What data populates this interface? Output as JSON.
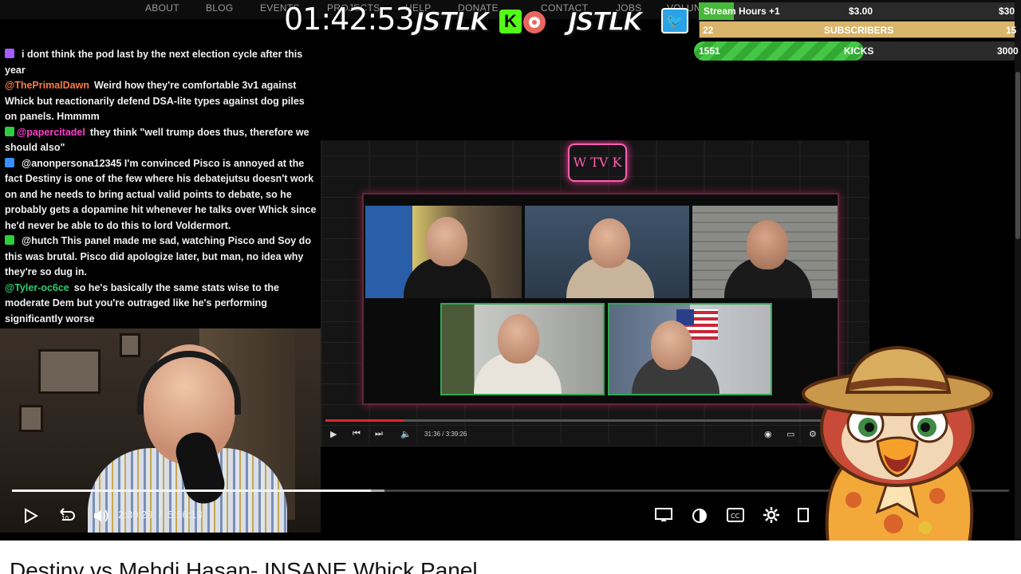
{
  "site_nav": [
    "ABOUT",
    "BLOG",
    "EVENTS",
    "PROJECTS",
    "HELP",
    "DONATE",
    "CONTACT",
    "JOBS",
    "VOLUNTEER"
  ],
  "overlay": {
    "timer": "01:42:53",
    "brand_left": "JSTLK",
    "brand_right": "JSTLK",
    "kick_letter": "K",
    "goals": {
      "stream_hours_label": "Stream Hours +1",
      "stream_hours_price": "$3.00",
      "stream_hours_goal": "$30",
      "subscribers_current": "22",
      "subscribers_label": "SUBSCRIBERS",
      "subscribers_goal": "15",
      "kicks_current": "1551",
      "kicks_label": "KICKS",
      "kicks_goal": "3000",
      "kicks_progress": 0.52
    },
    "colors": {
      "kick_green": "#53fc18",
      "twitter_blue": "#2aa2e8",
      "subs_gold": "#d8b56a"
    }
  },
  "chat": [
    {
      "user": "",
      "user_color": "#7b5cff",
      "badge_color": "#a35cff",
      "text": "i dont think the pod last by the next election cycle after this year"
    },
    {
      "user": "@ThePrimalDawn",
      "user_color": "#ff7a45",
      "badge_color": "",
      "text": "Weird how they're comfortable 3v1 against Whick but reactionarily defend DSA-lite types against dog piles on panels. Hmmmm"
    },
    {
      "user": "@papercitadel",
      "user_color": "#ff3fd0",
      "badge_color": "#2ecc40",
      "text": "they think \"well trump does thus, therefore we should also\""
    },
    {
      "user": "",
      "user_color": "#3a6dff",
      "badge_color": "#3a8dff",
      "text": "@anonpersona12345 I'm convinced Pisco is annoyed at the fact Destiny is one of the few where his debatejutsu doesn't work on and he needs to bring actual valid points to debate, so he probably gets a dopamine hit whenever he talks over Whick since he'd never be able to do this to lord Voldermort."
    },
    {
      "user": "",
      "user_color": "#ff2d2d",
      "badge_color": "#2ecc40",
      "text": "@hutch This panel made me sad, watching Pisco and Soy do this was brutal. Pisco did apologize later, but man, no idea why they're so dug in."
    },
    {
      "user": "@Tyler-oc6ce",
      "user_color": "#2ecc71",
      "badge_color": "",
      "text": "so he's basically the same stats wise to the moderate Dem but you're outraged like he's performing significantly worse"
    }
  ],
  "embedded_video": {
    "neon_sign": "W TV K",
    "time": "31:36 / 3:39:26"
  },
  "player": {
    "current_time": "2:30:29",
    "separator": "/",
    "duration": "5:56:13",
    "progress": 0.36,
    "skip_back_label": "10"
  },
  "page": {
    "video_title": "Destiny vs Mehdi Hasan- INSANE Whick Panel"
  }
}
